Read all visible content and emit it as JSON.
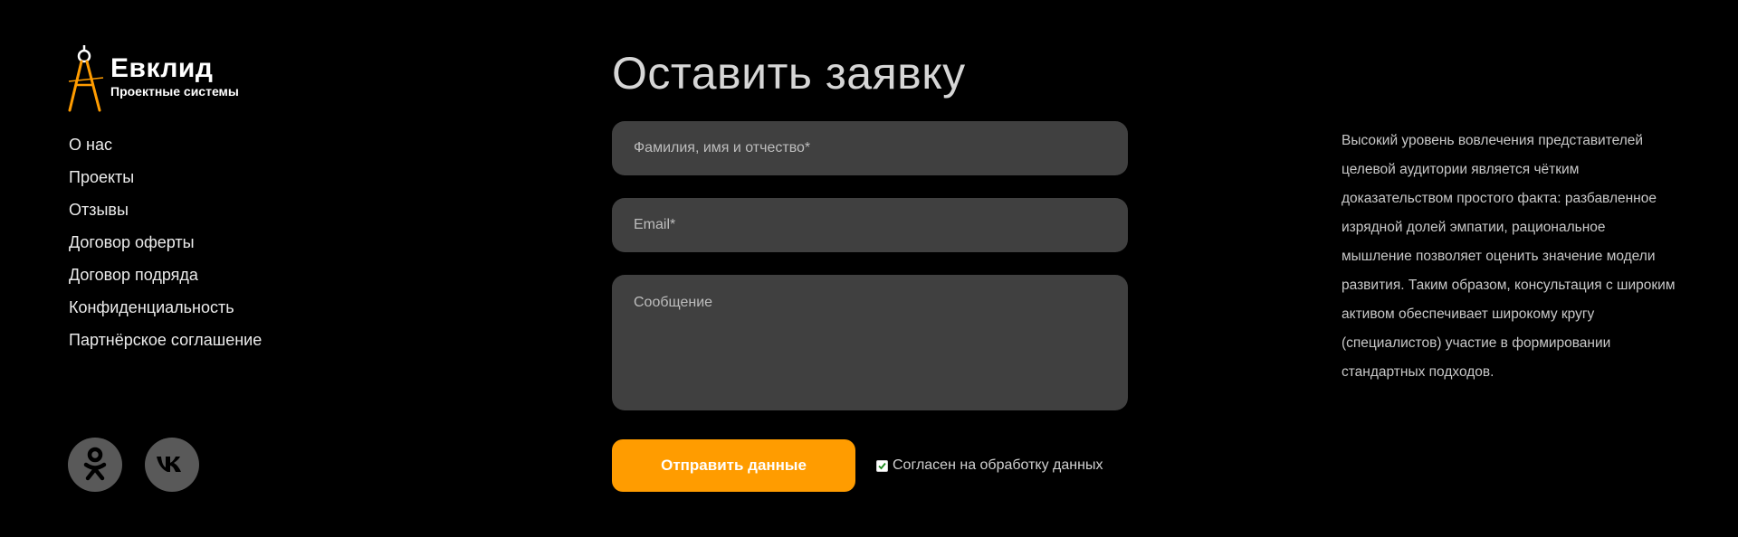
{
  "brand": {
    "name": "Евклид",
    "tagline": "Проектные системы",
    "accent_color": "#ff9c00",
    "logo_icon": "compass-icon"
  },
  "nav": {
    "items": [
      {
        "label": "О нас"
      },
      {
        "label": "Проекты"
      },
      {
        "label": "Отзывы"
      },
      {
        "label": "Договор оферты"
      },
      {
        "label": "Договор подряда"
      },
      {
        "label": "Конфиденциальность"
      },
      {
        "label": "Партнёрское соглашение"
      }
    ]
  },
  "social": {
    "items": [
      {
        "icon": "odnoklassniki-icon"
      },
      {
        "icon": "vk-icon"
      }
    ],
    "button_color": "#595959"
  },
  "form": {
    "title": "Оставить заявку",
    "name_placeholder": "Фамилия, имя и отчество*",
    "name_value": "",
    "email_placeholder": "Email*",
    "email_value": "",
    "message_placeholder": "Сообщение",
    "message_value": "",
    "submit_label": "Отправить данные",
    "consent_label": "Согласен на обработку данных",
    "consent_checked": true,
    "field_color": "#404040"
  },
  "info": {
    "text": "Высокий уровень вовлечения представителей целевой аудитории является чётким доказательством простого факта: разбавленное изрядной долей эмпатии, рациональное мышление позволяет оценить значение модели развития. Таким образом, консультация с широким активом обеспечивает широкому кругу (специалистов) участие в формировании стандартных подходов."
  }
}
